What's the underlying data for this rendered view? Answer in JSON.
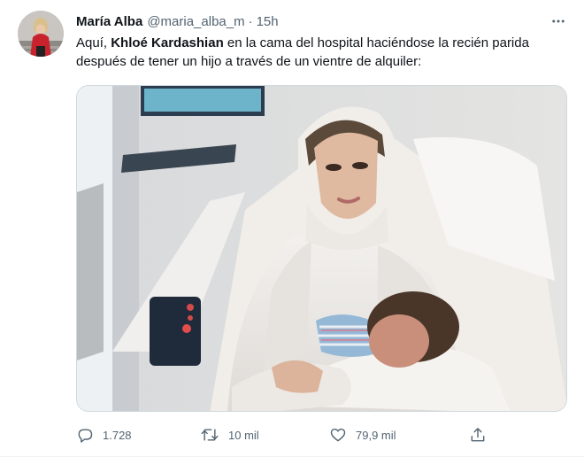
{
  "tweet": {
    "author": {
      "display_name": "María Alba",
      "handle": "@maria_alba_m",
      "separator": "·",
      "time": "15h"
    },
    "text_before": "Aquí, ",
    "text_bold": "Khloé Kardashian",
    "text_after": " en la cama del hospital haciéndose la recién parida después de tener un hijo a través de un vientre de alquiler:",
    "actions": {
      "replies": "1.728",
      "retweets": "10 mil",
      "likes": "79,9 mil"
    }
  },
  "icons": {
    "more": "more-icon",
    "reply": "reply-icon",
    "retweet": "retweet-icon",
    "like": "heart-icon",
    "share": "share-icon"
  },
  "colors": {
    "text": "#0f1419",
    "secondary": "#536471",
    "border": "#cfd9de"
  }
}
